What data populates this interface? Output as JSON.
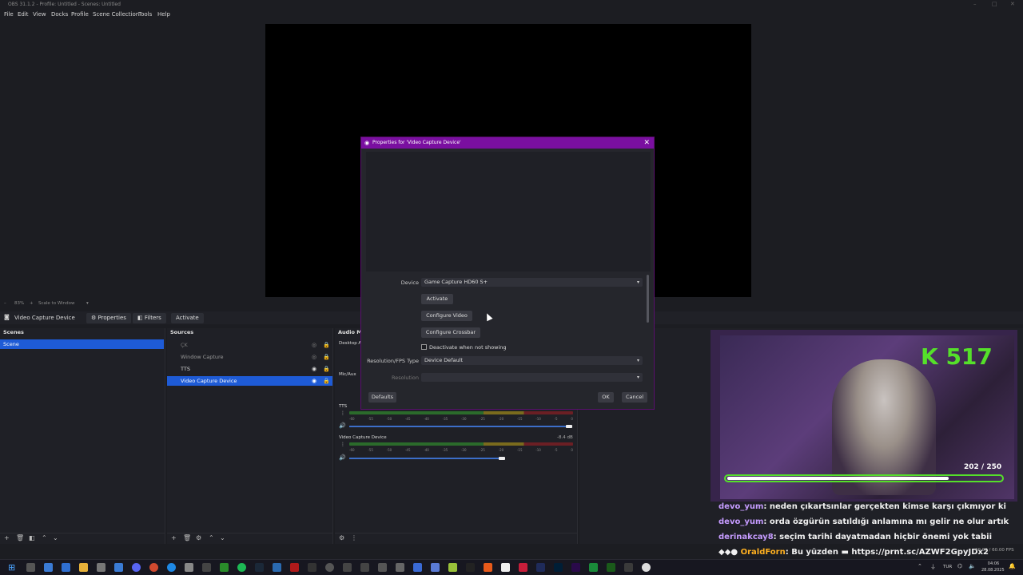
{
  "window": {
    "title": "OBS 31.1.2 - Profile: Untitled - Scenes: Untitled"
  },
  "menu": [
    "File",
    "Edit",
    "View",
    "Docks",
    "Profile",
    "Scene Collection",
    "Tools",
    "Help"
  ],
  "zoom": {
    "level": "83%",
    "mode": "Scale to Window"
  },
  "source_toolbar": {
    "source": "Video Capture Device",
    "properties": "Properties",
    "filters": "Filters",
    "activate": "Activate"
  },
  "scenes": {
    "header": "Scenes",
    "items": [
      "Scene"
    ]
  },
  "sources": {
    "header": "Sources",
    "items": [
      "ÇK",
      "Window Capture",
      "TTS",
      "Video Capture Device"
    ]
  },
  "audio": {
    "header": "Audio Mi",
    "channels": [
      {
        "name": "Desktop A"
      },
      {
        "name": "Mic/Aux"
      },
      {
        "name": "TTS"
      },
      {
        "name": "Video Capture Device",
        "level": "-8.4 dB"
      }
    ],
    "ticks": [
      "-60",
      "-55",
      "-50",
      "-45",
      "-40",
      "-35",
      "-30",
      "-25",
      "-20",
      "-15",
      "-10",
      "-5",
      "0"
    ]
  },
  "dialog": {
    "title": "Properties for 'Video Capture Device'",
    "device_label": "Device",
    "device_value": "Game Capture HD60 S+",
    "activate": "Activate",
    "configure_video": "Configure Video",
    "configure_crossbar": "Configure Crossbar",
    "deactivate": "Deactivate when not showing",
    "res_type_label": "Resolution/FPS Type",
    "res_type_value": "Device Default",
    "resolution_label": "Resolution",
    "defaults": "Defaults",
    "ok": "OK",
    "cancel": "Cancel"
  },
  "stream": {
    "kicks": "517",
    "hp": "202 / 250",
    "hp_fraction": 0.81,
    "fps": "60.00 / 60.00 FPS"
  },
  "chat": [
    {
      "user": "devo_yum",
      "msg": ": neden çıkartsınlar gerçekten kimse karşı çıkmıyor ki"
    },
    {
      "user": "devo_yum",
      "msg": ": orda özgürün satıldığı anlamına mı gelir ne olur artık"
    },
    {
      "user": "derinakcay8",
      "msg": ": seçim tarihi dayatmadan hiçbir önemi yok tabii"
    },
    {
      "user": "OraldForn",
      "msg": ": Bu yüzden",
      "link": "https://prnt.sc/AZWF2GpyJDx2"
    }
  ],
  "taskbar": {
    "lang": "TUR",
    "time": "04:06",
    "date": "28.08.2025"
  },
  "colors": {
    "accent": "#1e5bd6",
    "dialog_title": "#7a0fa0",
    "meter_green": "#2b6b2b",
    "overlay_green": "#55e02a"
  }
}
